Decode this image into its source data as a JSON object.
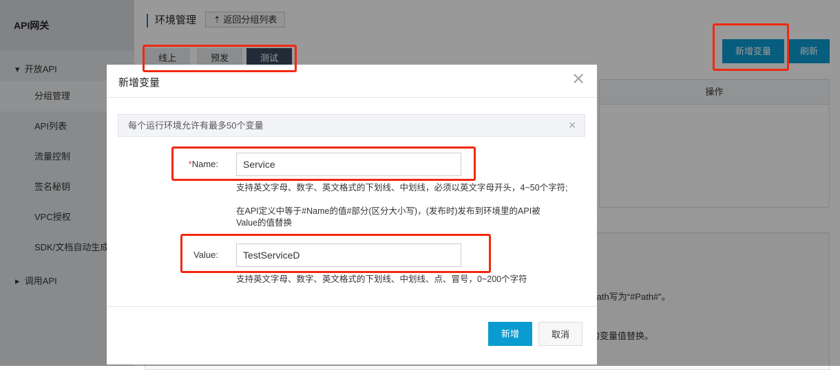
{
  "sidebar": {
    "title": "API网关",
    "groups": [
      {
        "label": "开放API",
        "expanded": true
      },
      {
        "label": "调用API",
        "expanded": false
      }
    ],
    "items": [
      "分组管理",
      "API列表",
      "流量控制",
      "签名秘钥",
      "VPC授权",
      "SDK/文档自动生成"
    ],
    "selected": "分组管理"
  },
  "header": {
    "title": "环境管理",
    "back_button": "返回分组列表"
  },
  "tabs": [
    {
      "label": "线上"
    },
    {
      "label": "预发"
    },
    {
      "label": "测试",
      "active": true
    }
  ],
  "toolbar": {
    "add_variable": "新增变量",
    "refresh": "刷新"
  },
  "table": {
    "column_action": "操作"
  },
  "info": {
    "line1": "Path写为“#Path#”。",
    "line2": "的变量值替换。"
  },
  "modal": {
    "title": "新增变量",
    "notice": "每个运行环境允许有最多50个变量",
    "name_label": "Name:",
    "name_value": "Service",
    "name_help1": "支持英文字母、数字、英文格式的下划线、中划线，必须以英文字母开头，4~50个字符;",
    "name_help2": "在API定义中等于#Name的值#部分(区分大小写)，(发布时)发布到环境里的API被Value的值替换",
    "value_label": "Value:",
    "value_value": "TestServiceD",
    "value_help": "支持英文字母、数字、英文格式的下划线、中划线、点、冒号，0~200个字符",
    "submit": "新增",
    "cancel": "取消"
  },
  "colors": {
    "primary": "#0a9bd1",
    "annotation": "#f2280f"
  }
}
